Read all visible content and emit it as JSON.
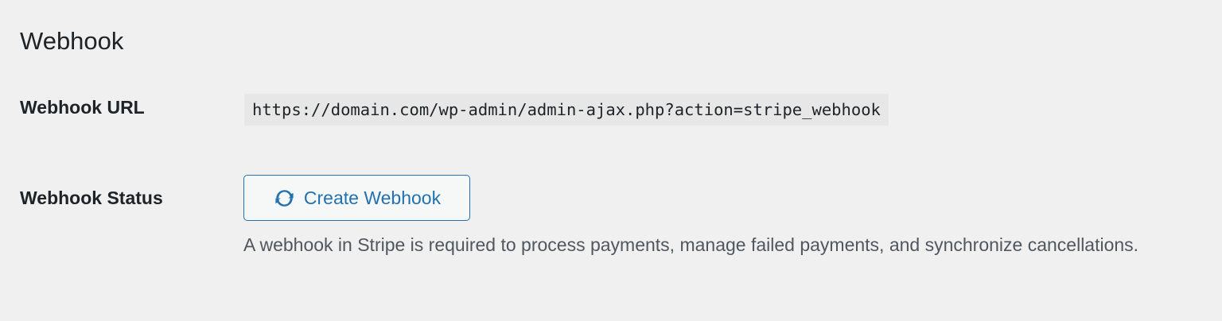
{
  "section": {
    "title": "Webhook"
  },
  "fields": {
    "url": {
      "label": "Webhook URL",
      "value": "https://domain.com/wp-admin/admin-ajax.php?action=stripe_webhook"
    },
    "status": {
      "label": "Webhook Status",
      "button_label": "Create Webhook",
      "button_icon": "sync-icon",
      "description": "A webhook in Stripe is required to process payments, manage failed payments, and synchronize cancellations."
    }
  },
  "colors": {
    "background": "#f0f0f1",
    "accent": "#2271b1",
    "text": "#1d2327",
    "muted_text": "#50575e",
    "code_background": "#e7e7e7"
  }
}
